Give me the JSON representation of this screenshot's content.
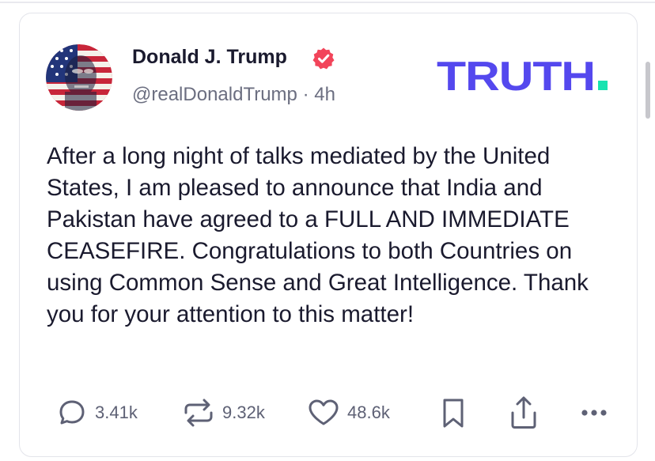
{
  "author": {
    "display_name": "Donald J. Trump",
    "handle": "@realDonaldTrump",
    "separator": "·",
    "time_ago": "4h",
    "verified": true,
    "avatar_icon": "flag-portrait-avatar"
  },
  "brand": {
    "logo_text": "TRUTH",
    "logo_color": "#5448ee",
    "logo_dot_color": "#17e3b0"
  },
  "post": {
    "text": "After a long night of talks mediated by the United States, I am pleased to announce that India and Pakistan have agreed to a FULL AND IMMEDIATE CEASEFIRE. Congratulations to both Countries on using Common Sense and Great Intelligence. Thank you for your attention to this matter!"
  },
  "actions": {
    "replies": {
      "icon": "reply-bubble-icon",
      "count": "3.41k"
    },
    "retruths": {
      "icon": "retruth-icon",
      "count": "9.32k"
    },
    "likes": {
      "icon": "heart-icon",
      "count": "48.6k"
    },
    "bookmark": {
      "icon": "bookmark-icon"
    },
    "share": {
      "icon": "share-icon"
    },
    "more": {
      "icon": "more-dots-icon"
    }
  },
  "colors": {
    "verified_badge": "#f2445a",
    "text_primary": "#1a1a2e",
    "text_secondary": "#6b6e80",
    "icon_gray": "#5e6175"
  }
}
